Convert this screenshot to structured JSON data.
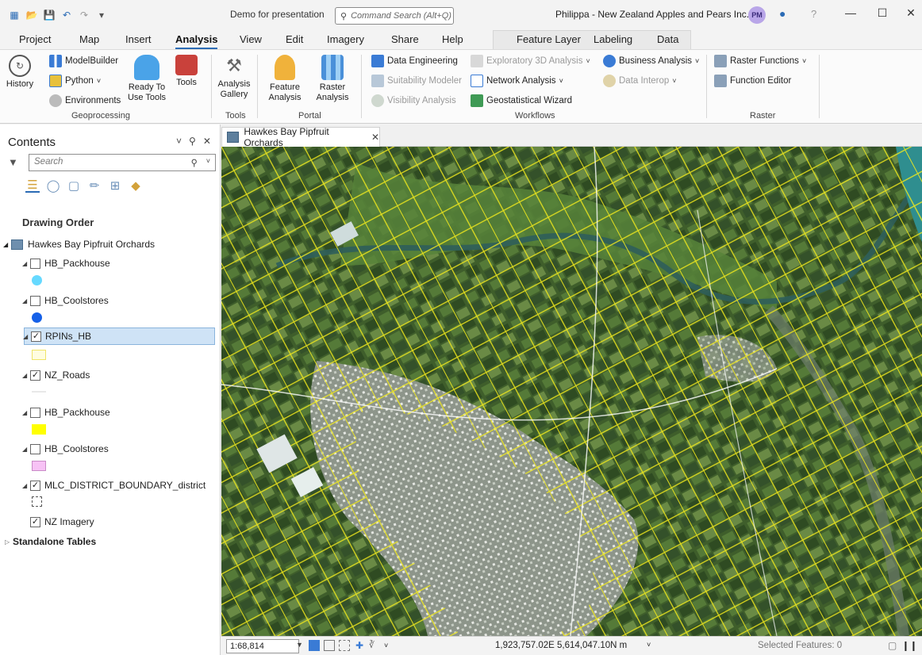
{
  "titlebar": {
    "doc_title": "Demo for presentation",
    "command_search_placeholder": "Command Search (Alt+Q)",
    "org_title": "Philippa - New Zealand Apples and Pears Inc.",
    "user_initials": "PM",
    "help_label": "?",
    "minimize_label": "—",
    "maximize_label": "☐",
    "close_label": "✕"
  },
  "tabs": [
    "Project",
    "Map",
    "Insert",
    "Analysis",
    "View",
    "Edit",
    "Imagery",
    "Share",
    "Help",
    "Feature Layer",
    "Labeling",
    "Data"
  ],
  "active_tab": "Analysis",
  "ribbon": {
    "history_label": "History",
    "modelbuilder_label": "ModelBuilder",
    "python_label": "Python",
    "environments_label": "Environments",
    "ready_to_use_label": "Ready To Use Tools",
    "tools_label": "Tools",
    "geoprocessing_group": "Geoprocessing",
    "analysis_gallery_label": "Analysis Gallery",
    "tools_group": "Tools",
    "feature_analysis_label": "Feature Analysis",
    "raster_analysis_label": "Raster Analysis",
    "portal_group": "Portal",
    "data_engineering_label": "Data Engineering",
    "suitability_modeler_label": "Suitability Modeler",
    "visibility_analysis_label": "Visibility Analysis",
    "exploratory_3d_label": "Exploratory 3D Analysis",
    "network_analysis_label": "Network Analysis",
    "geostatistical_wizard_label": "Geostatistical Wizard",
    "business_analysis_label": "Business Analysis",
    "data_interop_label": "Data Interop",
    "workflows_group": "Workflows",
    "raster_functions_label": "Raster Functions",
    "function_editor_label": "Function Editor",
    "raster_group": "Raster"
  },
  "contents": {
    "title": "Contents",
    "search_placeholder": "Search",
    "drawing_order_label": "Drawing Order",
    "map_name": "Hawkes Bay Pipfruit Orchards",
    "layers": [
      {
        "name": "HB_Packhouse",
        "checked": false,
        "symbol": "circle",
        "color": "#66d9ff"
      },
      {
        "name": "HB_Coolstores",
        "checked": false,
        "symbol": "circle",
        "color": "#1560e8"
      },
      {
        "name": "RPINs_HB",
        "checked": true,
        "symbol": "rect-outline",
        "color": "#fff7a8",
        "selected": true
      },
      {
        "name": "NZ_Roads",
        "checked": true,
        "symbol": "line",
        "color": "#ffffff"
      },
      {
        "name": "HB_Packhouse",
        "checked": false,
        "symbol": "rect",
        "color": "#ffff00"
      },
      {
        "name": "HB_Coolstores",
        "checked": false,
        "symbol": "rect",
        "color": "#f7c2f5"
      },
      {
        "name": "MLC_DISTRICT_BOUNDARY_district",
        "checked": true,
        "symbol": "dashed-rect",
        "color": "#555555"
      },
      {
        "name": "NZ Imagery",
        "checked": true,
        "symbol": "none",
        "color": ""
      }
    ],
    "standalone_tables_label": "Standalone Tables"
  },
  "map": {
    "tab_label": "Hawkes Bay Pipfruit Orchards",
    "tab_close": "✕",
    "parcel_outline_color": "#f2ea1c",
    "river_color": "#2f5e5a",
    "urban_color": "#c9cfc6",
    "vegetation_color": "#4b6a34"
  },
  "status": {
    "scale": "1:68,814",
    "coordinates": "1,923,757.02E 5,614,047.10N m",
    "selected_features": "Selected Features: 0"
  },
  "colors": {
    "accent": "#2b6bb5",
    "selection_bg": "#cfe3f6"
  }
}
